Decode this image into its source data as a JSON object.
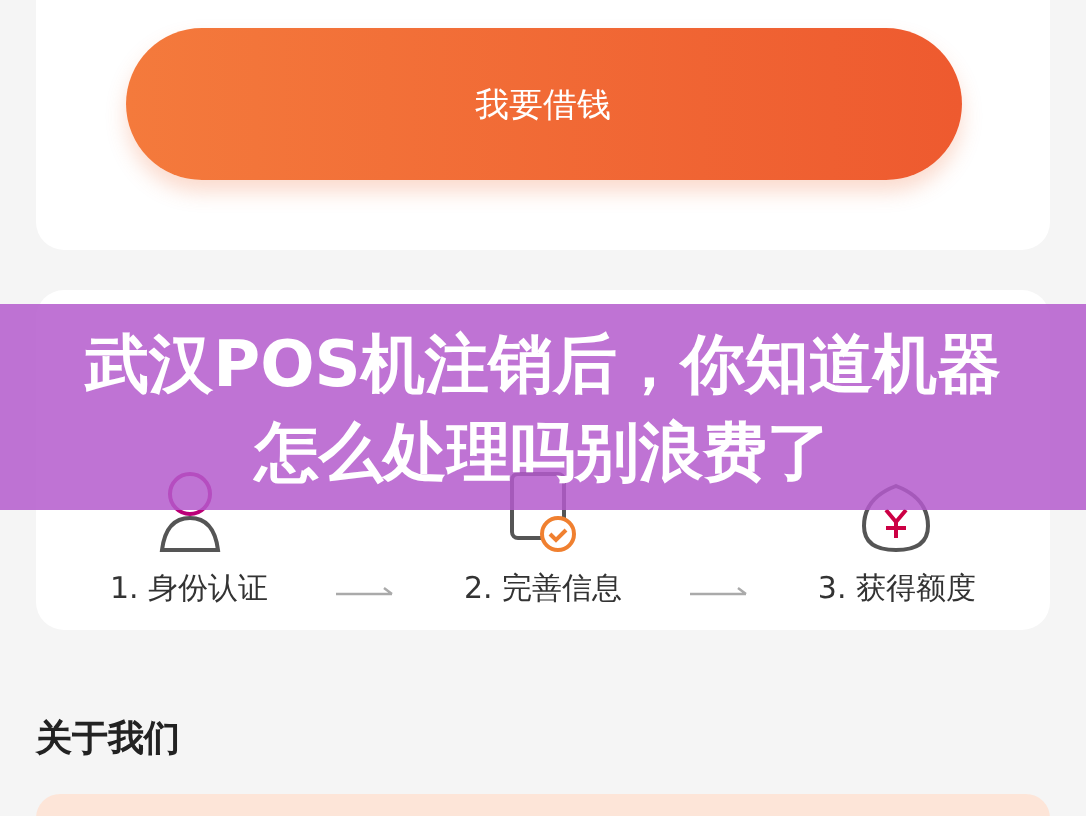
{
  "loan_card": {
    "button": "我要借钱"
  },
  "steps": [
    {
      "kind": "identity",
      "label": "1. 身份认证"
    },
    {
      "kind": "form",
      "label": "2. 完善信息"
    },
    {
      "kind": "money",
      "label": "3. 获得额度"
    }
  ],
  "about": {
    "heading": "关于我们"
  },
  "banner": {
    "title": "武汉POS机注销后，你知道机器怎么处理吗别浪费了"
  }
}
